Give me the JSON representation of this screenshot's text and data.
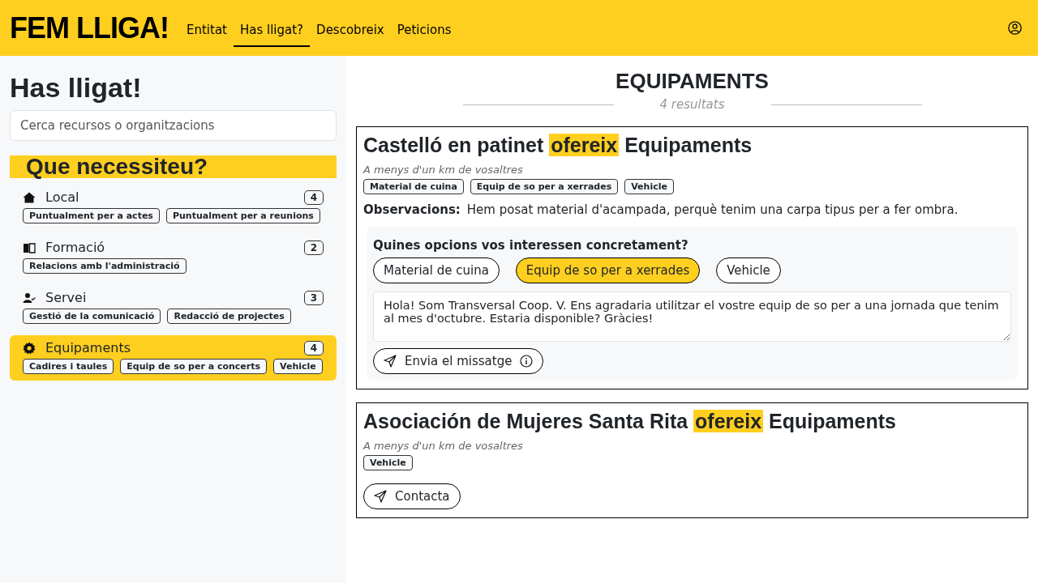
{
  "header": {
    "logo": "FEM LLIGA!",
    "nav": [
      {
        "label": "Entitat",
        "selected": false
      },
      {
        "label": "Has lligat?",
        "selected": true
      },
      {
        "label": "Descobreix",
        "selected": false
      },
      {
        "label": "Peticions",
        "selected": false
      }
    ]
  },
  "sidebar": {
    "title": "Has lligat!",
    "search": {
      "placeholder": "Cerca recursos o organitzacions"
    },
    "heading": "Que necessiteu?",
    "categories": [
      {
        "name": "Local",
        "count": "4",
        "selected": false,
        "tags": [
          "Puntualment per a actes",
          "Puntualment per a reunions"
        ]
      },
      {
        "name": "Formació",
        "count": "2",
        "selected": false,
        "tags": [
          "Relacions amb l'administració"
        ]
      },
      {
        "name": "Servei",
        "count": "3",
        "selected": false,
        "tags": [
          "Gestió de la comunicació",
          "Redacció de projectes"
        ]
      },
      {
        "name": "Equipaments",
        "count": "4",
        "selected": true,
        "tags": [
          "Cadires i taules",
          "Equip de so per a concerts",
          "Vehicle"
        ]
      }
    ]
  },
  "results": {
    "title": "EQUIPAMENTS",
    "count": "4 resultats",
    "cards": [
      {
        "kind": "form",
        "org": "Castelló en patinet",
        "verb": "ofereix",
        "category": "Equipaments",
        "distance": "A menys d'un km de vosaltres",
        "tags": [
          "Material de cuina",
          "Equip de so per a xerrades",
          "Vehicle"
        ],
        "observations_label": "Observacions:",
        "observations": "Hem posat material d'acampada, perquè tenim una carpa tipus per a fer ombra.",
        "question": "Quines opcions vos interessen concretament?",
        "options": [
          {
            "label": "Material de cuina",
            "selected": false
          },
          {
            "label": "Equip de so per a xerrades",
            "selected": true
          },
          {
            "label": "Vehicle",
            "selected": false
          }
        ],
        "message": "Hola! Som Transversal Coop. V. Ens agradaria utilitzar el vostre equip de so per a una jornada que tenim al mes d'octubre. Estaria disponible? Gràcies!",
        "button": "Envia el missatge"
      },
      {
        "kind": "contact",
        "org": "Asociación de Mujeres Santa Rita",
        "verb": "ofereix",
        "category": "Equipaments",
        "distance": "A menys d'un km de vosaltres",
        "tags": [
          "Vehicle"
        ],
        "button": "Contacta"
      }
    ]
  }
}
